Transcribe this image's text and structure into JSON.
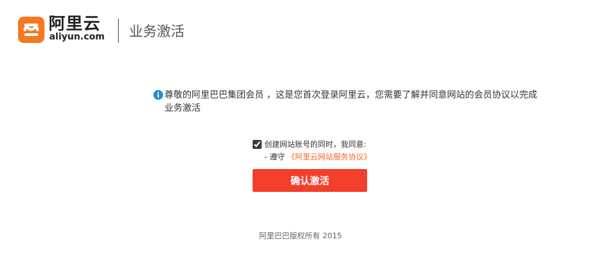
{
  "header": {
    "logo_cn": "阿里云",
    "logo_en": "aliyun.com",
    "page_title": "业务激活",
    "logo_color": "#f47920"
  },
  "notice": {
    "icon": "info-icon",
    "text": "尊敬的阿里巴巴集团会员 ，这是您首次登录阿里云，您需要了解并同意网站的会员协议以完成业务激活"
  },
  "agreement": {
    "checked": true,
    "label": "创建网站账号的同时，我同意:",
    "term_prefix": "- 遵守",
    "term_link": "《阿里云网站服务协议》",
    "link_color": "#f26722"
  },
  "confirm_button": {
    "label": "确认激活",
    "color": "#f33e2c"
  },
  "footer": {
    "copyright": "阿里巴巴版权所有 2015"
  }
}
